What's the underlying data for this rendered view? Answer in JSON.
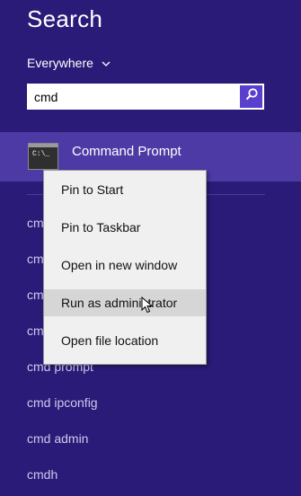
{
  "search": {
    "title": "Search",
    "scope_label": "Everywhere",
    "query": "cmd"
  },
  "top_result": {
    "label": "Command Prompt",
    "icon_text": "C:\\_"
  },
  "context_menu": {
    "items": [
      {
        "label": "Pin to Start"
      },
      {
        "label": "Pin to Taskbar"
      },
      {
        "label": "Open in new window"
      },
      {
        "label": "Run as administrator"
      },
      {
        "label": "Open file location"
      }
    ],
    "highlighted_index": 3
  },
  "suggestions": [
    {
      "label": "cmd"
    },
    {
      "label": "cmd"
    },
    {
      "label": "cmd"
    },
    {
      "label": "cmd"
    },
    {
      "label": "cmd prompt"
    },
    {
      "label": "cmd ipconfig"
    },
    {
      "label": "cmd admin"
    },
    {
      "label": "cmdh"
    }
  ],
  "colors": {
    "background": "#2b1b78",
    "result_highlight": "#4e3aa5",
    "search_button": "#5a3fcf",
    "menu_background": "#f0f0f0",
    "menu_hover": "#d6d6d6"
  }
}
